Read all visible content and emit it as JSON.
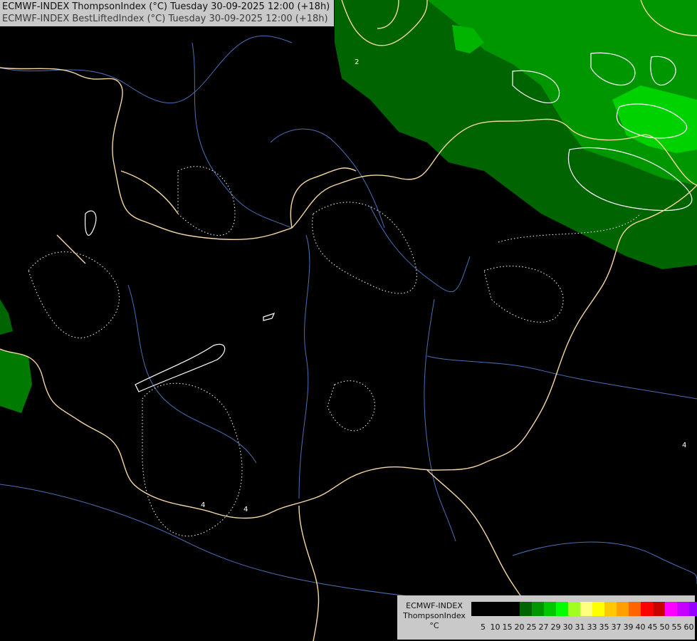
{
  "title": {
    "line1": "ECMWF-INDEX ThompsonIndex (°C) Tuesday 30-09-2025 12:00 (+18h)",
    "line2": "ECMWF-INDEX BestLiftedIndex (°C) Tuesday 30-09-2025 12:00 (+18h)"
  },
  "map": {
    "background_color": "#000000",
    "border_color": "#f5d7a3",
    "river_color": "#4a6fb5",
    "contour_color": "#ffffff",
    "fields": [
      {
        "name": "ThompsonIndex",
        "band": "20-25",
        "color": "#006400"
      },
      {
        "name": "ThompsonIndex",
        "band": "25-27",
        "color": "#009600"
      },
      {
        "name": "ThompsonIndex",
        "band": "27-29",
        "color": "#00d200"
      }
    ],
    "contour_labels": [
      "2",
      "4",
      "4",
      "4"
    ]
  },
  "legend": {
    "label_line1": "ECMWF-INDEX",
    "label_line2": "ThompsonIndex",
    "label_line3": "°C",
    "colors": [
      "#000000",
      "#000000",
      "#000000",
      "#000000",
      "#006400",
      "#009600",
      "#00c800",
      "#00ff00",
      "#a0ff20",
      "#ffff80",
      "#ffff00",
      "#ffc800",
      "#ffa000",
      "#ff6400",
      "#ff0000",
      "#c80000",
      "#ff00ff",
      "#c800ff",
      "#9600ff",
      "#6400ff",
      "#0000ff"
    ],
    "ticks": [
      "5",
      "10",
      "15",
      "20",
      "25",
      "27",
      "29",
      "30",
      "31",
      "33",
      "35",
      "37",
      "39",
      "40",
      "45",
      "50",
      "55",
      "60"
    ]
  }
}
